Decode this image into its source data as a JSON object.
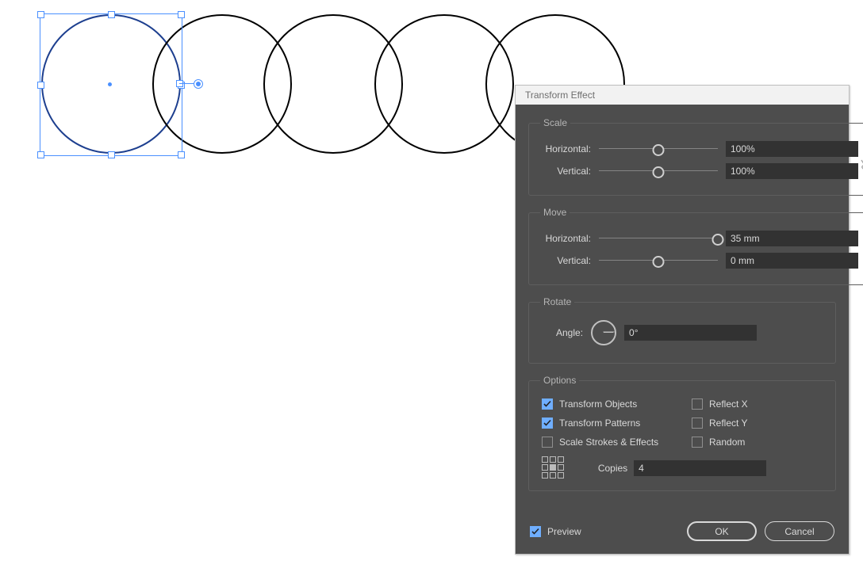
{
  "dialog": {
    "title": "Transform Effect",
    "scale": {
      "legend": "Scale",
      "horizontal_label": "Horizontal:",
      "horizontal_value": "100%",
      "horizontal_pct": 50,
      "vertical_label": "Vertical:",
      "vertical_value": "100%",
      "vertical_pct": 50
    },
    "move": {
      "legend": "Move",
      "horizontal_label": "Horizontal:",
      "horizontal_value": "35 mm",
      "horizontal_pct": 100,
      "vertical_label": "Vertical:",
      "vertical_value": "0 mm",
      "vertical_pct": 50
    },
    "rotate": {
      "legend": "Rotate",
      "angle_label": "Angle:",
      "angle_value": "0°"
    },
    "options": {
      "legend": "Options",
      "transform_objects": {
        "label": "Transform Objects",
        "checked": true
      },
      "reflect_x": {
        "label": "Reflect X",
        "checked": false
      },
      "transform_patterns": {
        "label": "Transform Patterns",
        "checked": true
      },
      "reflect_y": {
        "label": "Reflect Y",
        "checked": false
      },
      "scale_strokes": {
        "label": "Scale Strokes & Effects",
        "checked": false
      },
      "random": {
        "label": "Random",
        "checked": false
      },
      "copies_label": "Copies",
      "copies_value": "4"
    },
    "preview": {
      "label": "Preview",
      "checked": true
    },
    "ok_label": "OK",
    "cancel_label": "Cancel"
  },
  "canvas": {
    "circle_count": 5,
    "selected_index": 0
  }
}
